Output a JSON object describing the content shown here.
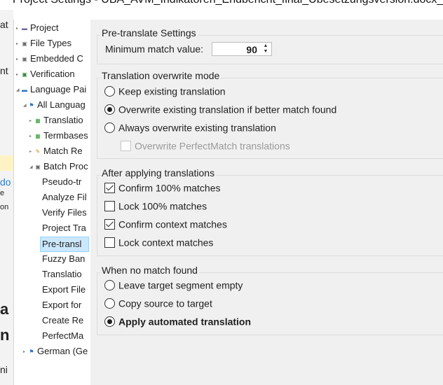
{
  "window": {
    "title": "Project Settings - UBA_AVM_Indikatoren_Endbericht_final_Übesetzungsversion.docx_de-DE_en"
  },
  "background_fragments": [
    "at",
    "nt",
    "do",
    "e",
    "on",
    "a",
    "n",
    "ni"
  ],
  "tree": {
    "items": [
      {
        "label": "Project",
        "icon": "project-icon",
        "glyph": "▬"
      },
      {
        "label": "File Types",
        "icon": "file-types-icon",
        "glyph": "▣"
      },
      {
        "label": "Embedded C",
        "icon": "embedded-content-icon",
        "glyph": "▣"
      },
      {
        "label": "Verification",
        "icon": "verification-icon",
        "glyph": "▣"
      },
      {
        "label": "Language Pai",
        "icon": "language-pairs-icon",
        "glyph": "▬"
      },
      {
        "label": "All Languag",
        "icon": "flag-icon",
        "glyph": "⚑"
      },
      {
        "label": "Translatio",
        "icon": "translation-memory-icon",
        "glyph": "▦"
      },
      {
        "label": "Termbases",
        "icon": "termbase-icon",
        "glyph": "▦"
      },
      {
        "label": "Match Re",
        "icon": "wrench-icon",
        "glyph": "✎"
      },
      {
        "label": "Batch Proc",
        "icon": "batch-icon",
        "glyph": "▣"
      },
      {
        "label": "Pseudo-tr"
      },
      {
        "label": "Analyze Fil"
      },
      {
        "label": "Verify Files"
      },
      {
        "label": "Project Tra"
      },
      {
        "label": "Pre-transl"
      },
      {
        "label": "Fuzzy Ban"
      },
      {
        "label": "Translatio"
      },
      {
        "label": "Export File"
      },
      {
        "label": "Export for"
      },
      {
        "label": "Create Re"
      },
      {
        "label": "PerfectMa"
      },
      {
        "label": "German (Ge",
        "icon": "flag-icon",
        "glyph": "⚑"
      }
    ]
  },
  "pretranslate": {
    "title": "Pre-translate Settings",
    "min_match_label": "Minimum match value:",
    "min_match_value": "90"
  },
  "overwrite": {
    "title": "Translation overwrite mode",
    "options": [
      {
        "label": "Keep existing translation",
        "checked": false
      },
      {
        "label": "Overwrite existing translation if better match found",
        "checked": true
      },
      {
        "label": "Always overwrite existing translation",
        "checked": false
      }
    ],
    "perfectmatch_label": "Overwrite PerfectMatch translations",
    "perfectmatch_checked": false
  },
  "after": {
    "title": "After applying translations",
    "options": [
      {
        "label": "Confirm 100% matches",
        "checked": true
      },
      {
        "label": "Lock 100% matches",
        "checked": false
      },
      {
        "label": "Confirm context matches",
        "checked": true
      },
      {
        "label": "Lock context matches",
        "checked": false
      }
    ]
  },
  "nomatch": {
    "title": "When no match found",
    "options": [
      {
        "label": "Leave target segment empty",
        "checked": false
      },
      {
        "label": "Copy source to target",
        "checked": false
      },
      {
        "label": "Apply automated translation",
        "checked": true
      }
    ]
  }
}
